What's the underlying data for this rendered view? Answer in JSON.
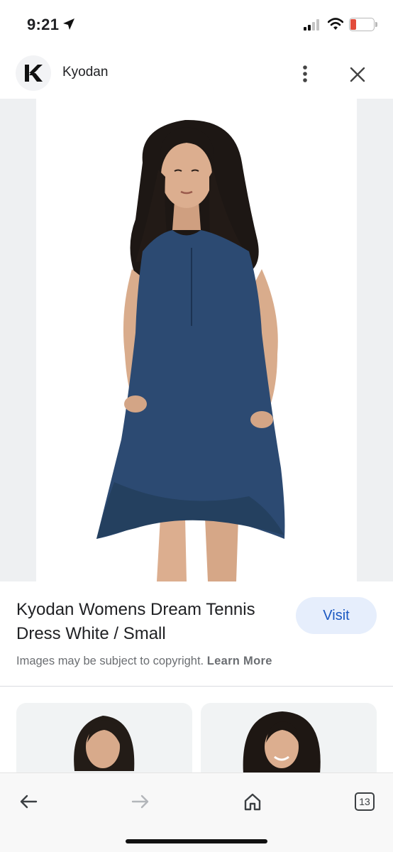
{
  "status_bar": {
    "time": "9:21",
    "battery_level": "7",
    "icons": [
      "location-arrow-icon",
      "cell-signal-icon",
      "wifi-icon",
      "battery-icon"
    ]
  },
  "header": {
    "site_name": "Kyodan",
    "logo_icon": "kyodan-logo-icon",
    "more_icon": "more-vert-icon",
    "close_icon": "close-icon"
  },
  "product": {
    "title": "Kyodan Womens Dream Tennis Dress White / Small",
    "visit_label": "Visit",
    "copyright_text": "Images may be subject to copyright.",
    "learn_more_label": "Learn More"
  },
  "related": {
    "cards": [
      "related-image-1",
      "related-image-2"
    ]
  },
  "bottom_nav": {
    "tab_count": "13",
    "icons": [
      "back-arrow-icon",
      "forward-arrow-icon",
      "home-icon",
      "tabs-icon"
    ]
  },
  "colors": {
    "accent": "#1a57c1",
    "visit_bg": "#e6eefc",
    "dress": "#2c4a72",
    "battery_low": "#e24b3b"
  }
}
